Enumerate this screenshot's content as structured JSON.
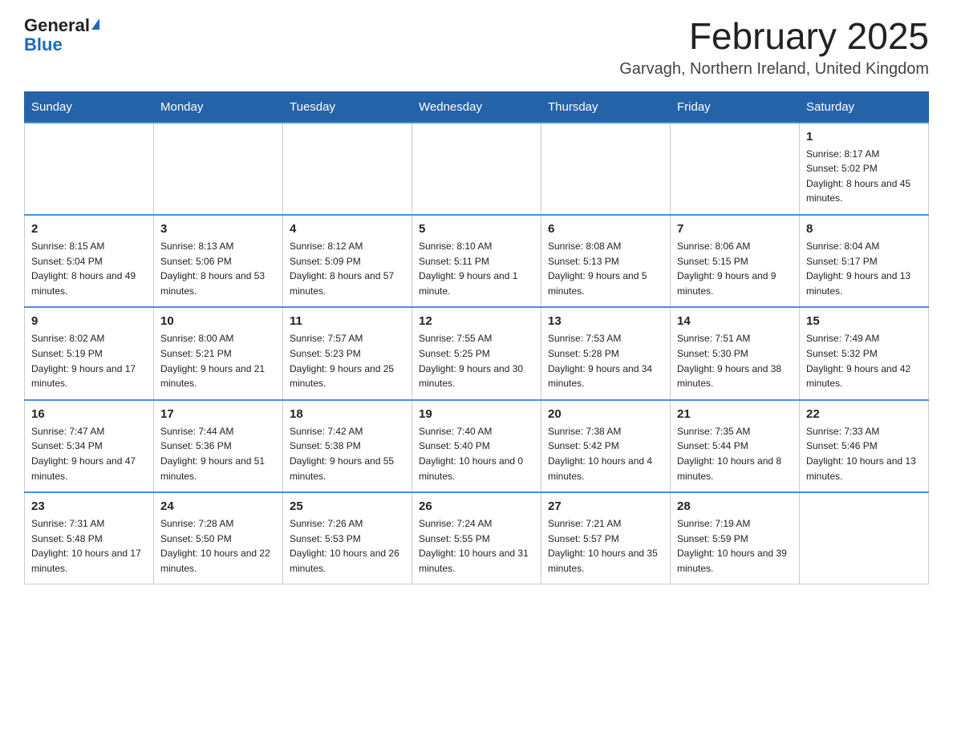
{
  "header": {
    "logo_general": "General",
    "logo_blue": "Blue",
    "month_title": "February 2025",
    "location": "Garvagh, Northern Ireland, United Kingdom"
  },
  "weekdays": [
    "Sunday",
    "Monday",
    "Tuesday",
    "Wednesday",
    "Thursday",
    "Friday",
    "Saturday"
  ],
  "weeks": [
    [
      {
        "day": "",
        "sunrise": "",
        "sunset": "",
        "daylight": ""
      },
      {
        "day": "",
        "sunrise": "",
        "sunset": "",
        "daylight": ""
      },
      {
        "day": "",
        "sunrise": "",
        "sunset": "",
        "daylight": ""
      },
      {
        "day": "",
        "sunrise": "",
        "sunset": "",
        "daylight": ""
      },
      {
        "day": "",
        "sunrise": "",
        "sunset": "",
        "daylight": ""
      },
      {
        "day": "",
        "sunrise": "",
        "sunset": "",
        "daylight": ""
      },
      {
        "day": "1",
        "sunrise": "Sunrise: 8:17 AM",
        "sunset": "Sunset: 5:02 PM",
        "daylight": "Daylight: 8 hours and 45 minutes."
      }
    ],
    [
      {
        "day": "2",
        "sunrise": "Sunrise: 8:15 AM",
        "sunset": "Sunset: 5:04 PM",
        "daylight": "Daylight: 8 hours and 49 minutes."
      },
      {
        "day": "3",
        "sunrise": "Sunrise: 8:13 AM",
        "sunset": "Sunset: 5:06 PM",
        "daylight": "Daylight: 8 hours and 53 minutes."
      },
      {
        "day": "4",
        "sunrise": "Sunrise: 8:12 AM",
        "sunset": "Sunset: 5:09 PM",
        "daylight": "Daylight: 8 hours and 57 minutes."
      },
      {
        "day": "5",
        "sunrise": "Sunrise: 8:10 AM",
        "sunset": "Sunset: 5:11 PM",
        "daylight": "Daylight: 9 hours and 1 minute."
      },
      {
        "day": "6",
        "sunrise": "Sunrise: 8:08 AM",
        "sunset": "Sunset: 5:13 PM",
        "daylight": "Daylight: 9 hours and 5 minutes."
      },
      {
        "day": "7",
        "sunrise": "Sunrise: 8:06 AM",
        "sunset": "Sunset: 5:15 PM",
        "daylight": "Daylight: 9 hours and 9 minutes."
      },
      {
        "day": "8",
        "sunrise": "Sunrise: 8:04 AM",
        "sunset": "Sunset: 5:17 PM",
        "daylight": "Daylight: 9 hours and 13 minutes."
      }
    ],
    [
      {
        "day": "9",
        "sunrise": "Sunrise: 8:02 AM",
        "sunset": "Sunset: 5:19 PM",
        "daylight": "Daylight: 9 hours and 17 minutes."
      },
      {
        "day": "10",
        "sunrise": "Sunrise: 8:00 AM",
        "sunset": "Sunset: 5:21 PM",
        "daylight": "Daylight: 9 hours and 21 minutes."
      },
      {
        "day": "11",
        "sunrise": "Sunrise: 7:57 AM",
        "sunset": "Sunset: 5:23 PM",
        "daylight": "Daylight: 9 hours and 25 minutes."
      },
      {
        "day": "12",
        "sunrise": "Sunrise: 7:55 AM",
        "sunset": "Sunset: 5:25 PM",
        "daylight": "Daylight: 9 hours and 30 minutes."
      },
      {
        "day": "13",
        "sunrise": "Sunrise: 7:53 AM",
        "sunset": "Sunset: 5:28 PM",
        "daylight": "Daylight: 9 hours and 34 minutes."
      },
      {
        "day": "14",
        "sunrise": "Sunrise: 7:51 AM",
        "sunset": "Sunset: 5:30 PM",
        "daylight": "Daylight: 9 hours and 38 minutes."
      },
      {
        "day": "15",
        "sunrise": "Sunrise: 7:49 AM",
        "sunset": "Sunset: 5:32 PM",
        "daylight": "Daylight: 9 hours and 42 minutes."
      }
    ],
    [
      {
        "day": "16",
        "sunrise": "Sunrise: 7:47 AM",
        "sunset": "Sunset: 5:34 PM",
        "daylight": "Daylight: 9 hours and 47 minutes."
      },
      {
        "day": "17",
        "sunrise": "Sunrise: 7:44 AM",
        "sunset": "Sunset: 5:36 PM",
        "daylight": "Daylight: 9 hours and 51 minutes."
      },
      {
        "day": "18",
        "sunrise": "Sunrise: 7:42 AM",
        "sunset": "Sunset: 5:38 PM",
        "daylight": "Daylight: 9 hours and 55 minutes."
      },
      {
        "day": "19",
        "sunrise": "Sunrise: 7:40 AM",
        "sunset": "Sunset: 5:40 PM",
        "daylight": "Daylight: 10 hours and 0 minutes."
      },
      {
        "day": "20",
        "sunrise": "Sunrise: 7:38 AM",
        "sunset": "Sunset: 5:42 PM",
        "daylight": "Daylight: 10 hours and 4 minutes."
      },
      {
        "day": "21",
        "sunrise": "Sunrise: 7:35 AM",
        "sunset": "Sunset: 5:44 PM",
        "daylight": "Daylight: 10 hours and 8 minutes."
      },
      {
        "day": "22",
        "sunrise": "Sunrise: 7:33 AM",
        "sunset": "Sunset: 5:46 PM",
        "daylight": "Daylight: 10 hours and 13 minutes."
      }
    ],
    [
      {
        "day": "23",
        "sunrise": "Sunrise: 7:31 AM",
        "sunset": "Sunset: 5:48 PM",
        "daylight": "Daylight: 10 hours and 17 minutes."
      },
      {
        "day": "24",
        "sunrise": "Sunrise: 7:28 AM",
        "sunset": "Sunset: 5:50 PM",
        "daylight": "Daylight: 10 hours and 22 minutes."
      },
      {
        "day": "25",
        "sunrise": "Sunrise: 7:26 AM",
        "sunset": "Sunset: 5:53 PM",
        "daylight": "Daylight: 10 hours and 26 minutes."
      },
      {
        "day": "26",
        "sunrise": "Sunrise: 7:24 AM",
        "sunset": "Sunset: 5:55 PM",
        "daylight": "Daylight: 10 hours and 31 minutes."
      },
      {
        "day": "27",
        "sunrise": "Sunrise: 7:21 AM",
        "sunset": "Sunset: 5:57 PM",
        "daylight": "Daylight: 10 hours and 35 minutes."
      },
      {
        "day": "28",
        "sunrise": "Sunrise: 7:19 AM",
        "sunset": "Sunset: 5:59 PM",
        "daylight": "Daylight: 10 hours and 39 minutes."
      },
      {
        "day": "",
        "sunrise": "",
        "sunset": "",
        "daylight": ""
      }
    ]
  ]
}
